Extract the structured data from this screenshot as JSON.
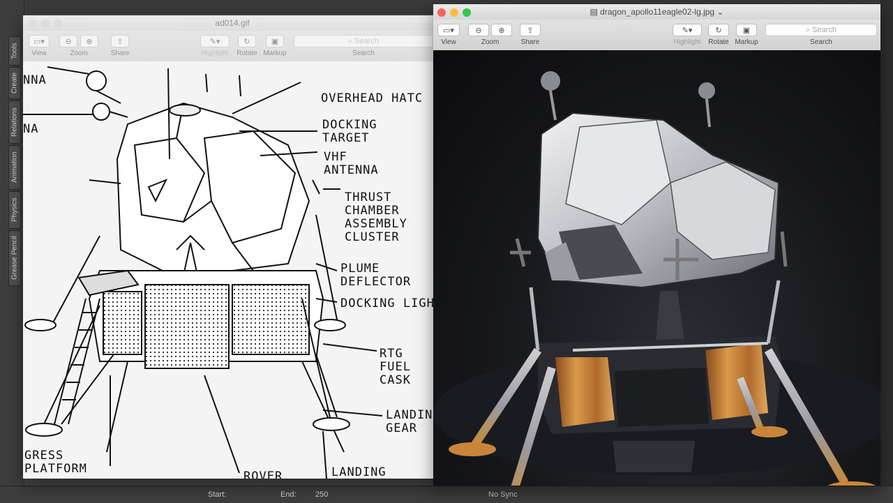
{
  "background_app": {
    "side_tabs": [
      "Tools",
      "Create",
      "Relations",
      "Animation",
      "Physics",
      "Grease Pencil"
    ],
    "bottom_bar": {
      "start_label": "Start:",
      "end_label": "End:",
      "end_value": "250",
      "sync": "No Sync"
    }
  },
  "left_window": {
    "title": "ad014.gif",
    "toolbar": {
      "view": "View",
      "zoom": "Zoom",
      "share": "Share",
      "highlight": "Highlight",
      "rotate": "Rotate",
      "markup": "Markup",
      "search_placeholder": "Search",
      "search_label": "Search"
    },
    "labels": {
      "antenna_1": "NNA",
      "antenna_2": "NA",
      "overhead_hatch": "OVERHEAD HATC",
      "docking_target": "DOCKING\nTARGET",
      "vhf_antenna": "VHF\nANTENNA",
      "thrust_chamber": "THRUST\nCHAMBER\nASSEMBLY\nCLUSTER",
      "plume_deflector": "PLUME\nDEFLECTOR",
      "docking_light": "DOCKING LIGH",
      "rtg_fuel_cask": "RTG\nFUEL\nCASK",
      "landing_gear": "LANDIN\nGEAR",
      "egress_platform": "GRESS\nPLATFORM",
      "rover": "ROVER",
      "landing_probe": "LANDING\nPROBE"
    }
  },
  "right_window": {
    "title": "dragon_apollo11eagle02-lg.jpg",
    "toolbar": {
      "view": "View",
      "zoom": "Zoom",
      "share": "Share",
      "highlight": "Highlight",
      "rotate": "Rotate",
      "markup": "Markup",
      "search_placeholder": "Search",
      "search_label": "Search"
    }
  },
  "colors": {
    "close": "#fc605c",
    "minimize": "#fdbc40",
    "zoom": "#34c84a",
    "gold_foil": "#c9853a"
  }
}
